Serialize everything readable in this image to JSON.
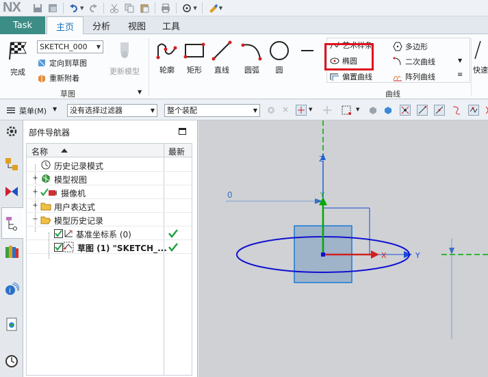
{
  "app": {
    "logo": "NX"
  },
  "tabs": [
    {
      "label": "Task"
    },
    {
      "label": "主页"
    },
    {
      "label": "分析"
    },
    {
      "label": "视图"
    },
    {
      "label": "工具"
    }
  ],
  "ribbon": {
    "finish_label": "完成",
    "sketch_name": "SKETCH_000",
    "orient_label": "定向到草图",
    "reattach_label": "重新附着",
    "update_model_label": "更新模型",
    "sketch_group_label": "草图",
    "curve_tools": [
      {
        "label": "轮廓"
      },
      {
        "label": "矩形"
      },
      {
        "label": "直线"
      },
      {
        "label": "圆弧"
      },
      {
        "label": "圆"
      }
    ],
    "gallery": {
      "col1": [
        {
          "label": "艺术样条"
        },
        {
          "label": "椭圆"
        },
        {
          "label": "偏置曲线"
        }
      ],
      "col2": [
        {
          "label": "多边形"
        },
        {
          "label": "二次曲线"
        },
        {
          "label": "阵列曲线"
        }
      ]
    },
    "curve_group_label": "曲线",
    "quick_label": "快速"
  },
  "toolbar": {
    "menu_label": "菜单(M)",
    "filter_value": "没有选择过滤器",
    "assembly_value": "整个装配"
  },
  "navigator": {
    "title": "部件导航器",
    "col_name": "名称",
    "col_latest": "最新",
    "rows": [
      {
        "label": "历史记录模式"
      },
      {
        "label": "模型视图"
      },
      {
        "label": "摄像机"
      },
      {
        "label": "用户表达式"
      },
      {
        "label": "模型历史记录"
      },
      {
        "label": "基准坐标系 (0)"
      },
      {
        "label": "草图 (1) \"SKETCH_..."
      }
    ]
  },
  "graphics": {
    "dim_value": "0",
    "axis_z": "Z",
    "axis_y": "Y",
    "axis_x": "X",
    "axis_y2": "Y"
  },
  "colors": {
    "task_tab": "#3c8d86",
    "highlight": "#e0101d",
    "sketch_curve": "#1010d0",
    "axis_green": "#00aa00",
    "axis_red": "#d02020"
  }
}
